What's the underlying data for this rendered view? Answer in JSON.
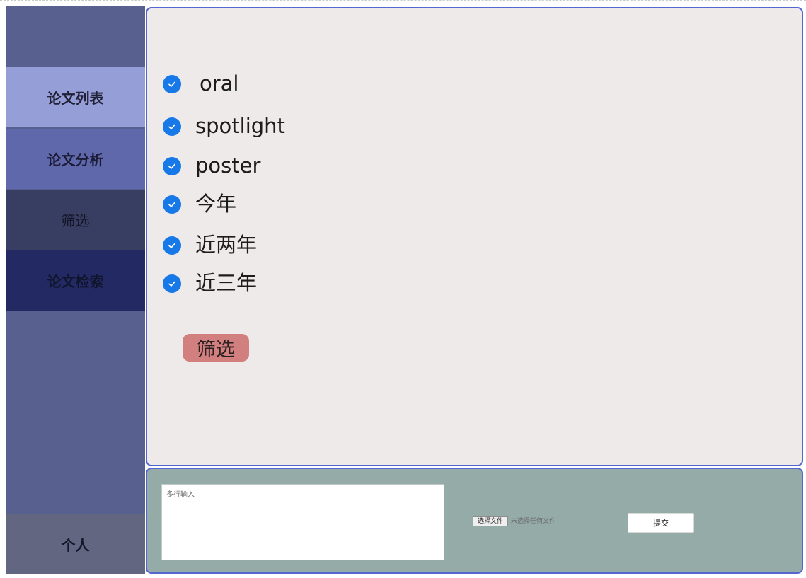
{
  "sidebar": {
    "items": [
      {
        "label": "论文列表"
      },
      {
        "label": "论文分析"
      },
      {
        "label": "筛选"
      },
      {
        "label": "论文检索"
      }
    ],
    "personal_label": "个人"
  },
  "filter": {
    "options": [
      {
        "label": "oral",
        "checked": true
      },
      {
        "label": "spotlight",
        "checked": true
      },
      {
        "label": "poster",
        "checked": true
      },
      {
        "label": "今年",
        "checked": true
      },
      {
        "label": "近两年",
        "checked": true
      },
      {
        "label": "近三年",
        "checked": true
      }
    ],
    "button_label": "筛选"
  },
  "upload": {
    "textarea_placeholder": "多行输入",
    "file_button_label": "选择文件",
    "file_status": "未选择任何文件",
    "submit_label": "提交"
  },
  "colors": {
    "sidebar_bg": "#58608f",
    "active_item": "#959ed6",
    "checkbox": "#1778e8",
    "filter_button": "#d17f7f",
    "panel_border": "#5467d1",
    "bottom_panel": "#94aba8",
    "main_panel": "#efeaea"
  }
}
